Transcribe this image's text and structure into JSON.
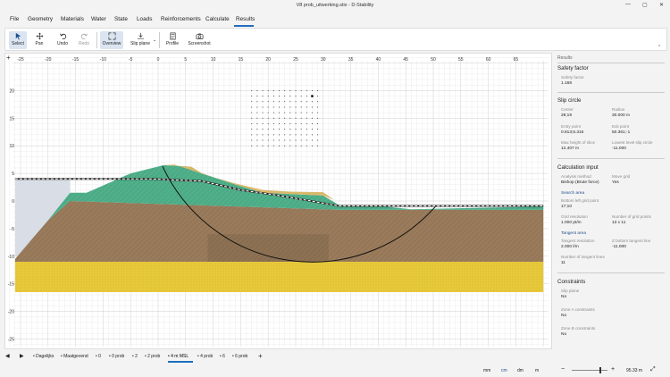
{
  "window": {
    "title": "V8 prob_uitwerking.stix - D-Stability",
    "min": "—",
    "max": "▢",
    "close": "✕"
  },
  "menu": {
    "items": [
      "File",
      "Geometry",
      "Materials",
      "Water",
      "State",
      "Loads",
      "Reinforcements",
      "Calculate",
      "Results"
    ],
    "active": "Results"
  },
  "toolbar": {
    "select": "Select",
    "pan": "Pan",
    "undo": "Undo",
    "redo": "Redo",
    "overview": "Overview",
    "slip_plane": "Slip plane",
    "profile": "Profile",
    "screenshot": "Screenshot"
  },
  "canvas": {
    "x_ticks": [
      "-25",
      "-20",
      "-15",
      "-10",
      "-5",
      "0",
      "5",
      "10",
      "15",
      "20",
      "25",
      "30",
      "35",
      "40",
      "45",
      "50",
      "55",
      "60",
      "65"
    ],
    "y_ticks": [
      "20",
      "15",
      "10",
      "5",
      "0",
      "-5",
      "-10",
      "-15",
      "-20",
      "-25"
    ],
    "corner_icon": "+",
    "colors": {
      "sand": "#e8c93a",
      "clay_green": "#4fb08a",
      "peat_brown": "#9a7b5b",
      "top_layer": "#d9b86b",
      "water_area": "#d8dde6"
    }
  },
  "results_panel": {
    "heading": "Results",
    "safety_factor": {
      "title": "Safety factor",
      "label": "Safety factor",
      "value": "1.168"
    },
    "slip_circle": {
      "title": "Slip circle",
      "center_label": "Center",
      "center_value": "28;19",
      "radius_label": "Radius",
      "radius_value": "30.000 m",
      "entry_label": "Entry point",
      "entry_value": "0.813;6.316",
      "exit_label": "Exit point",
      "exit_value": "50.361;-1",
      "max_height_label": "Max height of slice",
      "max_height_value": "12.407 m",
      "lowest_label": "Lowest level slip circle",
      "lowest_value": "-11.000"
    },
    "calculation_input": {
      "title": "Calculation input",
      "method_label": "Analysis method",
      "method_value": "Bishop (Brute force)",
      "move_grid_label": "Move grid",
      "move_grid_value": "Yes",
      "search_area": "Search area",
      "bottom_left_label": "Bottom left grid point",
      "bottom_left_value": "17;10",
      "grid_res_label": "Grid resolution",
      "grid_res_value": "1.000 pt/m",
      "grid_points_label": "Number of grid points",
      "grid_points_value": "13 x 11",
      "tangent_area": "Tangent area",
      "tangent_res_label": "Tangent resolution",
      "tangent_res_value": "2.000 l/m",
      "z_bottom_label": "Z bottom tangent line",
      "z_bottom_value": "-11.000",
      "tangent_lines_label": "Number of tangent lines",
      "tangent_lines_value": "11"
    },
    "constraints": {
      "title": "Constraints",
      "slip_plane_label": "Slip plane",
      "slip_plane_value": "No",
      "zone_a_label": "Zone A constraints",
      "zone_a_value": "No",
      "zone_b_label": "Zone B constraints",
      "zone_b_value": "No"
    }
  },
  "tabs": {
    "items": [
      "Dagelijks",
      "Maatgevend",
      "0",
      "0 prob",
      "2",
      "2 prob",
      "4 m MSL",
      "4 prob",
      "6",
      "6 prob"
    ],
    "active": "4 m MSL",
    "add": "+"
  },
  "status": {
    "units": [
      "mm",
      "cm",
      "dm",
      "m"
    ],
    "active_unit": "cm",
    "zoom": "95.33 m"
  }
}
